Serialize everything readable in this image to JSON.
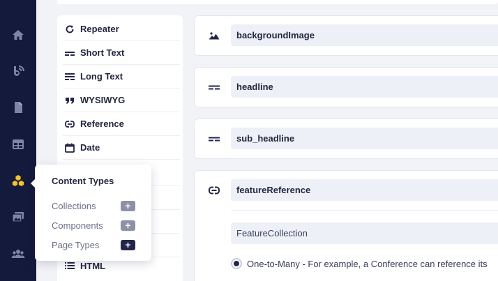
{
  "colors": {
    "rail": "#141a3c",
    "rail_icon": "#7f85a8",
    "rail_active": "#f3c623",
    "plus_muted": "#8d90a6",
    "plus_dark": "#23264a",
    "input_bg": "#eef0f8"
  },
  "rail": {
    "items": [
      {
        "icon": "home-icon"
      },
      {
        "icon": "blog-icon"
      },
      {
        "icon": "document-icon"
      },
      {
        "icon": "table-icon"
      },
      {
        "icon": "content-types-icon",
        "active": true
      },
      {
        "icon": "media-icon"
      },
      {
        "icon": "users-icon"
      }
    ]
  },
  "fields": {
    "items": [
      {
        "label": "Repeater",
        "icon": "repeat-icon"
      },
      {
        "label": "Short Text",
        "icon": "short-text-icon"
      },
      {
        "label": "Long Text",
        "icon": "long-text-icon"
      },
      {
        "label": "WYSIWYG",
        "icon": "quote-icon"
      },
      {
        "label": "Reference",
        "icon": "link-icon"
      },
      {
        "label": "Date",
        "icon": "calendar-icon"
      },
      {
        "label": "HTML",
        "icon": "list-icon"
      }
    ]
  },
  "cards": [
    {
      "name": "backgroundImage",
      "icon": "image-icon"
    },
    {
      "name": "headline",
      "icon": "short-text-icon"
    },
    {
      "name": "sub_headline",
      "icon": "short-text-icon"
    },
    {
      "name": "featureReference",
      "icon": "link-icon",
      "reference_value": "FeatureCollection",
      "radio_label": "One-to-Many - For example, a Conference can reference its"
    }
  ],
  "popover": {
    "title": "Content Types",
    "rows": [
      {
        "label": "Collections",
        "plus": "+"
      },
      {
        "label": "Components",
        "plus": "+"
      },
      {
        "label": "Page Types",
        "plus": "+"
      }
    ]
  }
}
